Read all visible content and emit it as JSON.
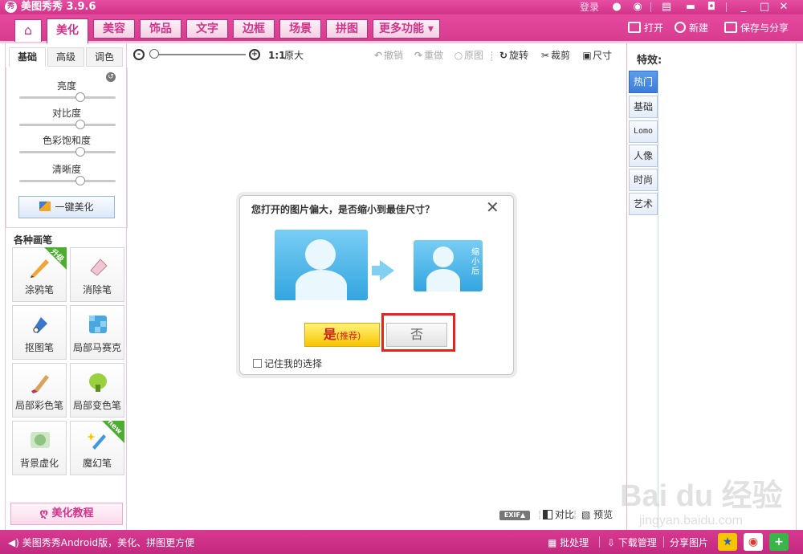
{
  "window": {
    "logo": "秀",
    "title": "美图秀秀 3.9.6",
    "login": "登录"
  },
  "nav": {
    "tabs": [
      "美化",
      "美容",
      "饰品",
      "文字",
      "边框",
      "场景",
      "拼图",
      "更多功能 ▾"
    ],
    "active": "美化",
    "open": "打开",
    "new": "新建",
    "save": "保存与分享"
  },
  "left": {
    "subtabs": [
      "基础",
      "高级",
      "调色"
    ],
    "sliders": [
      {
        "label": "亮度",
        "value": 0.5
      },
      {
        "label": "对比度",
        "value": 0.5
      },
      {
        "label": "色彩饱和度",
        "value": 0.5
      },
      {
        "label": "清晰度",
        "value": 0.5
      }
    ],
    "oneclick": "一键美化",
    "brushes_title": "各种画笔",
    "brushes": [
      {
        "label": "涂鸦笔",
        "badge": "升级"
      },
      {
        "label": "消除笔",
        "badge": ""
      },
      {
        "label": "抠图笔",
        "badge": ""
      },
      {
        "label": "局部马赛克",
        "badge": ""
      },
      {
        "label": "局部彩色笔",
        "badge": ""
      },
      {
        "label": "局部变色笔",
        "badge": ""
      },
      {
        "label": "背景虚化",
        "badge": ""
      },
      {
        "label": "魔幻笔",
        "badge": "new"
      }
    ],
    "tutorial": "美化教程"
  },
  "toolbar": {
    "ratio": "1:1",
    "original_size": "原大",
    "undo": "撤销",
    "redo": "重做",
    "original": "原图",
    "rotate": "旋转",
    "crop": "裁剪",
    "size": "尺寸"
  },
  "dialog": {
    "title": "您打开的图片偏大，是否缩小到最佳尺寸？",
    "small_label": "缩小后",
    "yes": "是",
    "yes_note": "(推荐)",
    "no": "否",
    "remember": "记住我的选择"
  },
  "bottom_tools": {
    "exif": "EXIF▲",
    "compare": "对比",
    "preview": "预览"
  },
  "effects": {
    "title": "特效:",
    "tabs": [
      "热门",
      "基础",
      "Lomo",
      "人像",
      "时尚",
      "艺术"
    ],
    "active": "热门"
  },
  "status": {
    "text": "美图秀秀Android版，美化、拼图更方便",
    "batch": "批处理",
    "download": "下载管理",
    "share": "分享图片"
  },
  "watermark": {
    "brand": "Bai du 经验",
    "url": "jingyan.baidu.com"
  },
  "colors": {
    "brand": "#d83c8f",
    "highlight": "#e8221b",
    "yes_button": "#f7c500"
  }
}
